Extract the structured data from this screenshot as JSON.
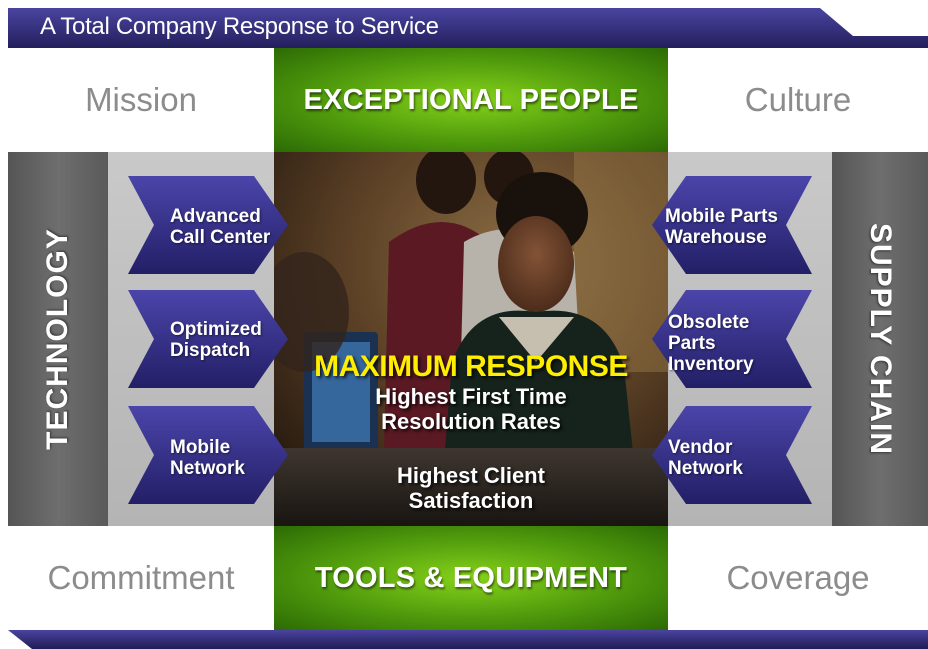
{
  "header": {
    "title": "A Total Company Response to Service"
  },
  "corners": {
    "top_left": "Mission",
    "top_right": "Culture",
    "bottom_left": "Commitment",
    "bottom_right": "Coverage"
  },
  "pillars": {
    "top": "EXCEPTIONAL PEOPLE",
    "bottom": "TOOLS & EQUIPMENT",
    "left": "TECHNOLOGY",
    "right": "SUPPLY CHAIN"
  },
  "technology_items": [
    {
      "label": "Advanced\nCall Center"
    },
    {
      "label": "Optimized\nDispatch"
    },
    {
      "label": "Mobile\nNetwork"
    }
  ],
  "supply_chain_items": [
    {
      "label": "Mobile Parts\nWarehouse"
    },
    {
      "label": "Obsolete\nParts\nInventory"
    },
    {
      "label": "Vendor\nNetwork"
    }
  ],
  "center": {
    "title": "MAXIMUM RESPONSE",
    "line1": "Highest First Time\nResolution Rates",
    "line2": "Highest Client\nSatisfaction"
  },
  "colors": {
    "banner": "#2e2770",
    "arrow": "#3a3596",
    "green": "#5aa80f",
    "side_gray": "#666666",
    "title_yellow": "#ffee00"
  }
}
